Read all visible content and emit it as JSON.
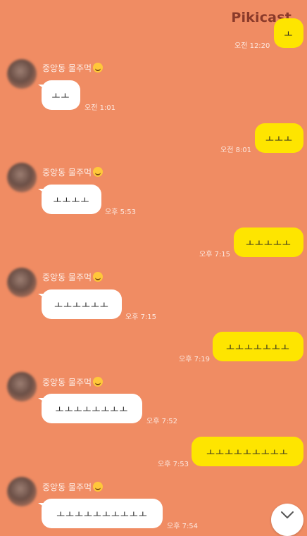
{
  "watermark": "Pikicast",
  "sender_name": "중앙동 물주먹",
  "messages": [
    {
      "side": "mine",
      "text": "ㅗ",
      "time": "오전 12:20"
    },
    {
      "side": "theirs",
      "text": "ㅗㅗ",
      "time": "오전 1:01"
    },
    {
      "side": "mine",
      "text": "ㅗㅗㅗ",
      "time": "오전 8:01"
    },
    {
      "side": "theirs",
      "text": "ㅗㅗㅗㅗ",
      "time": "오후 5:53"
    },
    {
      "side": "mine",
      "text": "ㅗㅗㅗㅗㅗ",
      "time": "오후 7:15"
    },
    {
      "side": "theirs",
      "text": "ㅗㅗㅗㅗㅗㅗ",
      "time": "오후 7:15"
    },
    {
      "side": "mine",
      "text": "ㅗㅗㅗㅗㅗㅗㅗ",
      "time": "오후 7:19"
    },
    {
      "side": "theirs",
      "text": "ㅗㅗㅗㅗㅗㅗㅗㅗ",
      "time": "오후 7:52"
    },
    {
      "side": "mine",
      "text": "ㅗㅗㅗㅗㅗㅗㅗㅗㅗ",
      "time": "오후 7:53"
    },
    {
      "side": "theirs",
      "text": "ㅗㅗㅗㅗㅗㅗㅗㅗㅗㅗ",
      "time": "오후 7:54"
    }
  ],
  "scroll_icon": "chevron-down-icon"
}
